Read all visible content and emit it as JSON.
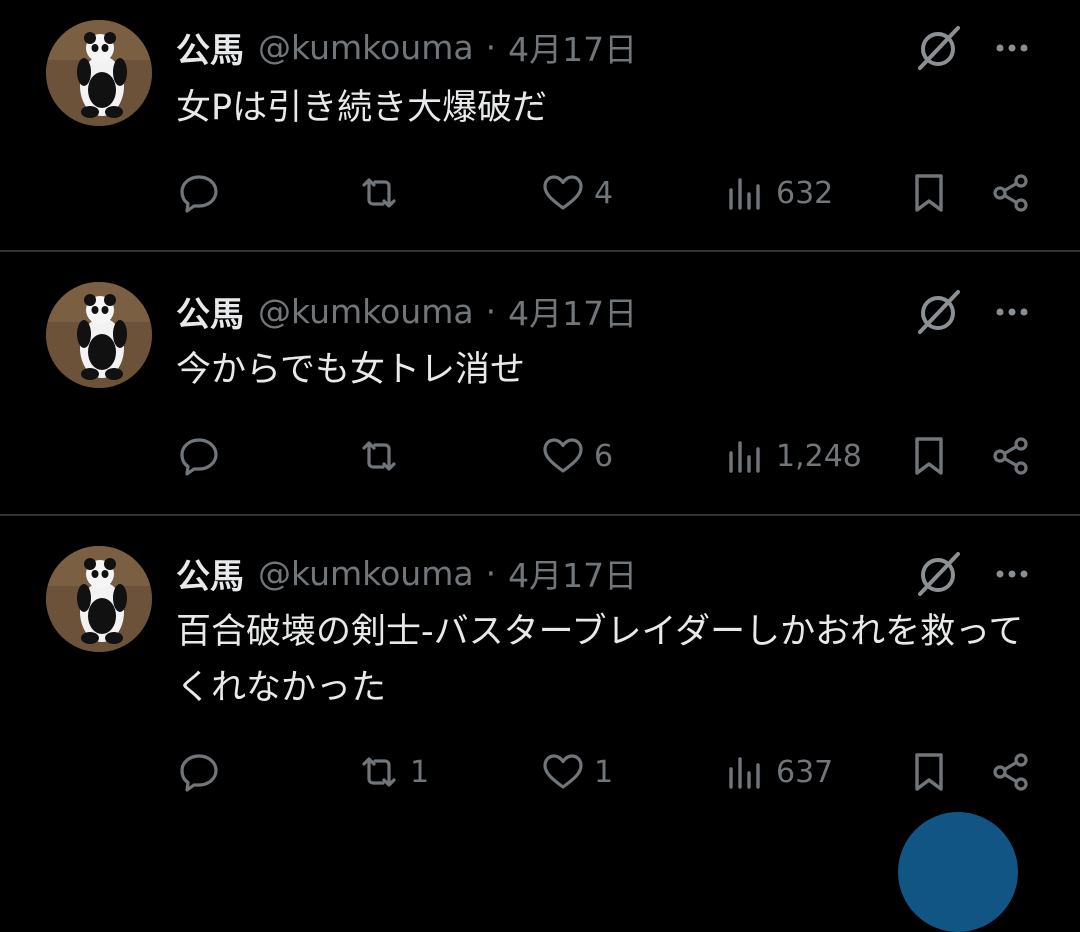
{
  "tweets": [
    {
      "name": "公馬",
      "handle": "@kumkouma",
      "separator": "·",
      "date": "4月17日",
      "text": "女Pは引き続き大爆破だ",
      "reply_count": "",
      "retweet_count": "",
      "like_count": "4",
      "view_count": "632"
    },
    {
      "name": "公馬",
      "handle": "@kumkouma",
      "separator": "·",
      "date": "4月17日",
      "text": "今からでも女トレ消せ",
      "reply_count": "",
      "retweet_count": "",
      "like_count": "6",
      "view_count": "1,248"
    },
    {
      "name": "公馬",
      "handle": "@kumkouma",
      "separator": "·",
      "date": "4月17日",
      "text": "百合破壊の剣士-バスターブレイダーしかおれを救ってくれなかった",
      "reply_count": "",
      "retweet_count": "1",
      "like_count": "1",
      "view_count": "637"
    }
  ],
  "icons": {
    "grok": "grok-icon",
    "more": "more-icon",
    "reply": "reply-icon",
    "retweet": "retweet-icon",
    "like": "heart-icon",
    "views": "views-icon",
    "bookmark": "bookmark-icon",
    "share": "share-icon"
  },
  "colors": {
    "background": "#000000",
    "text": "#e7e9ea",
    "secondary": "#71767b",
    "divider": "#2f3336",
    "accent": "#1d9bf0"
  }
}
